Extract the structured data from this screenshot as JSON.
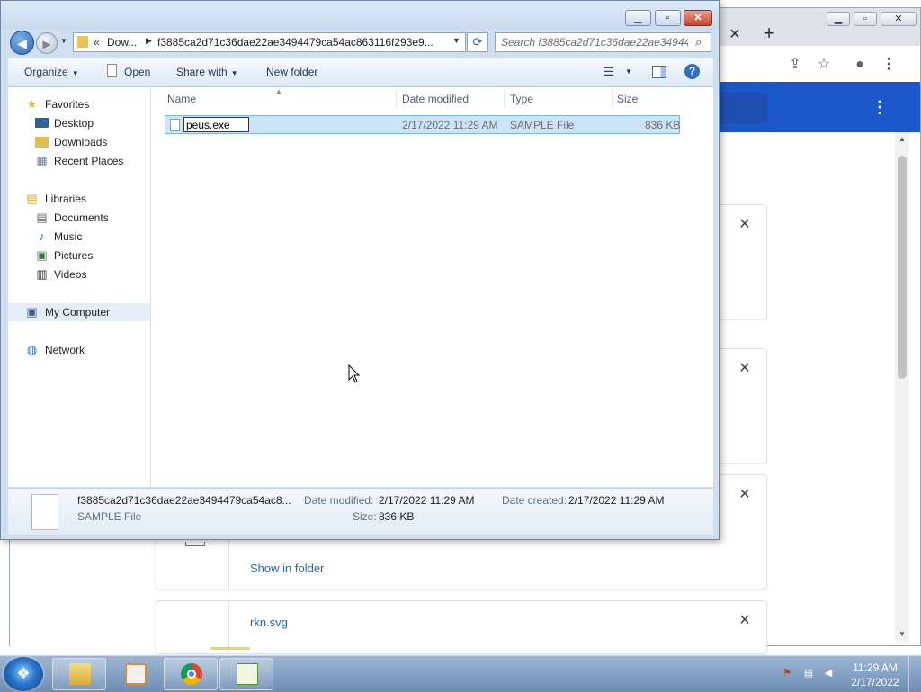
{
  "chrome": {
    "tab_close": "✕",
    "new_tab": "+",
    "share_icon": "⇪",
    "star_icon": "☆",
    "profile_icon": "●",
    "menu_icon": "⋮",
    "downloads": [
      {
        "close": "✕"
      },
      {
        "close": "✕"
      },
      {
        "close": "✕",
        "action": "Show in folder"
      },
      {
        "close": "✕",
        "filename": "rkn.svg"
      }
    ]
  },
  "explorer": {
    "address": {
      "chevron": "«",
      "segment1": "Dow...",
      "segment2": "f3885ca2d71c36dae22ae3494479ca54ac863116f293e9..."
    },
    "search_placeholder": "Search f3885ca2d71c36dae22ae34944...",
    "toolbar": {
      "organize": "Organize",
      "open": "Open",
      "share_with": "Share with",
      "new_folder": "New folder"
    },
    "nav": {
      "favorites": "Favorites",
      "desktop": "Desktop",
      "downloads": "Downloads",
      "recent_places": "Recent Places",
      "libraries": "Libraries",
      "documents": "Documents",
      "music": "Music",
      "pictures": "Pictures",
      "videos": "Videos",
      "my_computer": "My Computer",
      "network": "Network"
    },
    "columns": {
      "name": "Name",
      "date_modified": "Date modified",
      "type": "Type",
      "size": "Size"
    },
    "file": {
      "rename_value": "peus.exe",
      "date_modified": "2/17/2022 11:29 AM",
      "type": "SAMPLE File",
      "size": "836 KB"
    },
    "details": {
      "filename": "f3885ca2d71c36dae22ae3494479ca54ac8...",
      "filetype": "SAMPLE File",
      "date_modified_label": "Date modified:",
      "date_modified_value": "2/17/2022 11:29 AM",
      "size_label": "Size:",
      "size_value": "836 KB",
      "date_created_label": "Date created:",
      "date_created_value": "2/17/2022 11:29 AM"
    }
  },
  "taskbar": {
    "time": "11:29 AM",
    "date": "2/17/2022"
  },
  "colors": {
    "chrome_blue": "#1a57c9",
    "link_blue": "#1a66c8",
    "selection": "#cce4f7"
  }
}
